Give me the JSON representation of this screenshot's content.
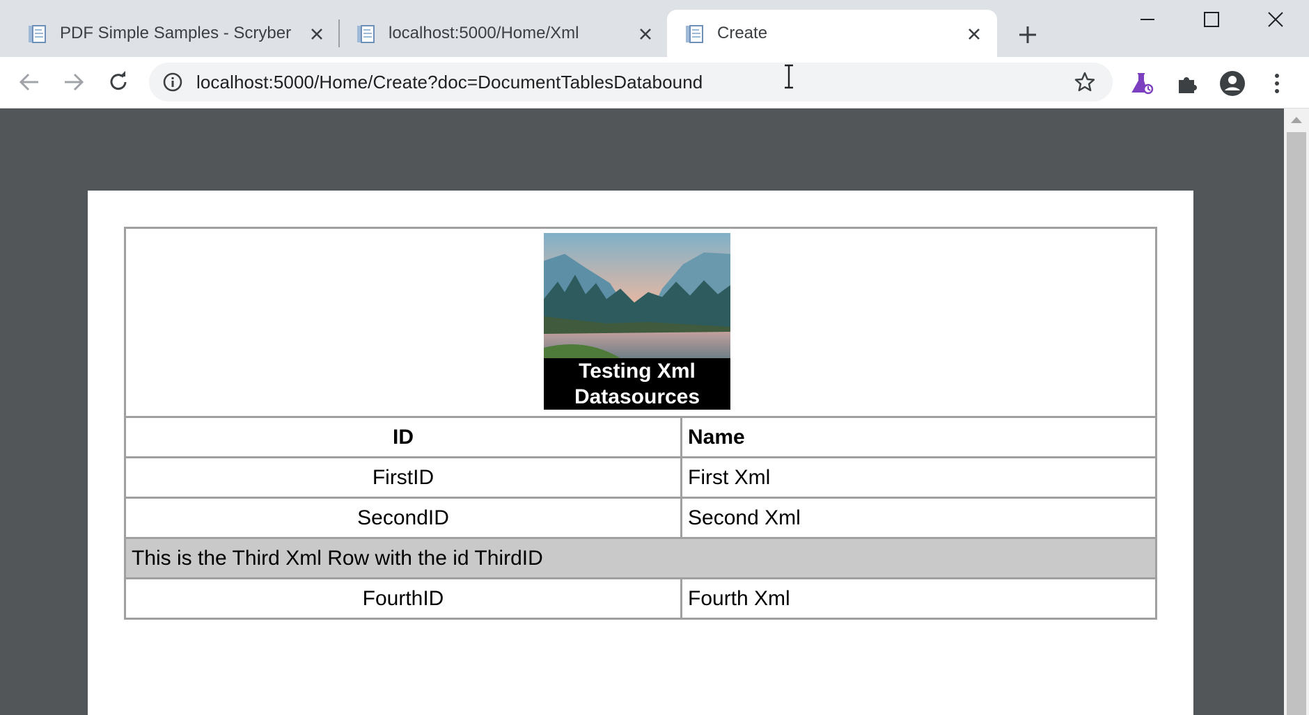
{
  "browser": {
    "tabs": [
      {
        "title": "PDF Simple Samples - Scryber",
        "active": false
      },
      {
        "title": "localhost:5000/Home/Xml",
        "active": false
      },
      {
        "title": "Create",
        "active": true
      }
    ],
    "new_tab_icon": "plus-icon",
    "address": "localhost:5000/Home/Create?doc=DocumentTablesDatabound",
    "colors": {
      "tabstrip": "#dee1e6",
      "omnibox": "#f1f3f4",
      "viewer_bg": "#525659",
      "extension_accent": "#7b3fbf"
    }
  },
  "document": {
    "header_image": {
      "caption_line1": "Testing Xml",
      "caption_line2": "Datasources"
    },
    "table": {
      "headers": {
        "id": "ID",
        "name": "Name"
      },
      "rows": [
        {
          "id": "FirstID",
          "name": "First Xml"
        },
        {
          "id": "SecondID",
          "name": "Second Xml"
        },
        {
          "span_text": "This is the Third Xml Row with the id ThirdID"
        },
        {
          "id": "FourthID",
          "name": "Fourth Xml"
        }
      ],
      "colors": {
        "border": "#a0a0a0",
        "span_row_bg": "#c9c9c9"
      }
    }
  }
}
